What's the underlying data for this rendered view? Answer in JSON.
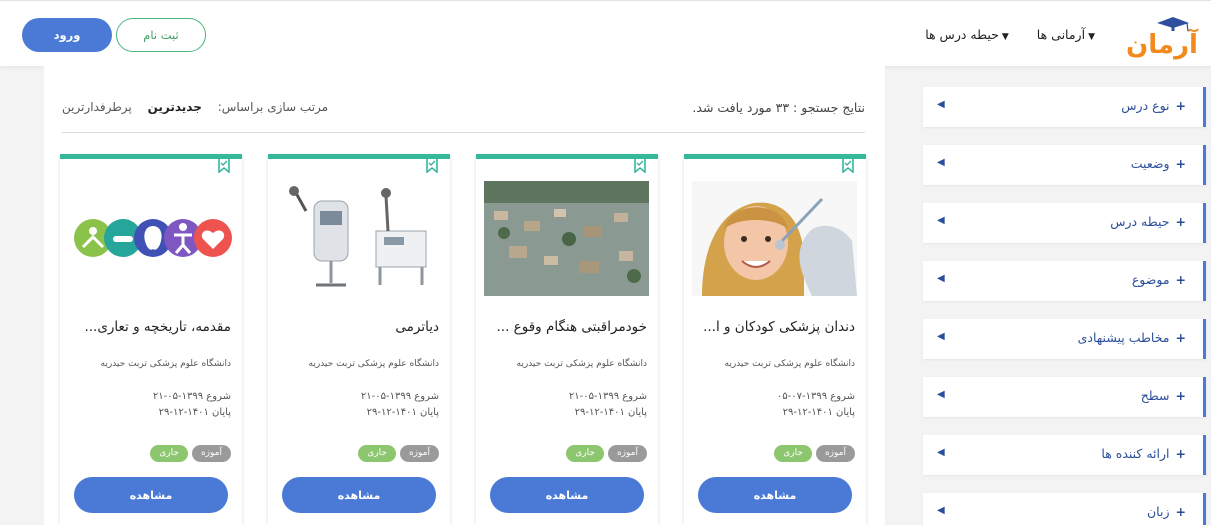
{
  "header": {
    "logo_text": "آرمان",
    "nav": [
      {
        "label": "آرمانی ها"
      },
      {
        "label": "حیطه درس ها"
      }
    ],
    "login_label": "ورود",
    "signup_label": "ثبت نام"
  },
  "sidebar": {
    "filters": [
      {
        "label": "نوع درس"
      },
      {
        "label": "وضعیت"
      },
      {
        "label": "حیطه درس"
      },
      {
        "label": "موضوع"
      },
      {
        "label": "مخاطب پیشنهادی"
      },
      {
        "label": "سطح"
      },
      {
        "label": "ارائه کننده ها"
      },
      {
        "label": "زبان"
      }
    ]
  },
  "results": {
    "summary": "نتایج جستجو : ۳۳ مورد یافت شد.",
    "sort_label": "مرتب سازی براساس:",
    "sort_options": [
      "جدیدترین",
      "پرطرفدارترین"
    ]
  },
  "courses": [
    {
      "title": "دندان پزشکی کودکان و ا...",
      "university": "دانشگاه علوم پزشکی تربت حیدریه",
      "start": "شروع ۱۳۹۹-۰۷-۰۵",
      "end": "پایان ۱۴۰۱-۱۲-۲۹",
      "tags": [
        "آموزه",
        "جاری"
      ],
      "button": "مشاهده"
    },
    {
      "title": "خودمراقبتی هنگام وقوع ...",
      "university": "دانشگاه علوم پزشکی تربت حیدریه",
      "start": "شروع ۱۳۹۹-۰۵-۲۱",
      "end": "پایان ۱۴۰۱-۱۲-۲۹",
      "tags": [
        "آموزه",
        "جاری"
      ],
      "button": "مشاهده"
    },
    {
      "title": "دیاترمی",
      "university": "دانشگاه علوم پزشکی تربت حیدریه",
      "start": "شروع ۱۳۹۹-۰۵-۲۱",
      "end": "پایان ۱۴۰۱-۱۲-۲۹",
      "tags": [
        "آموزه",
        "جاری"
      ],
      "button": "مشاهده"
    },
    {
      "title": "مقدمه، تاریخچه و تعاری...",
      "university": "دانشگاه علوم پزشکی تربت حیدریه",
      "start": "شروع ۱۳۹۹-۰۵-۲۱",
      "end": "پایان ۱۴۰۱-۱۲-۲۹",
      "tags": [
        "آموزه",
        "جاری"
      ],
      "button": "مشاهده"
    }
  ],
  "icons": {
    "bookmark": "bookmark-icon",
    "filter_arrow": "caret-left-icon",
    "nav_caret": "caret-down-icon"
  },
  "colors": {
    "primary": "#4a7ad6",
    "accent": "#35b89a",
    "tag_gray": "#9a9a9a",
    "tag_green": "#8cc66e",
    "logo_orange": "#f28a1e"
  }
}
